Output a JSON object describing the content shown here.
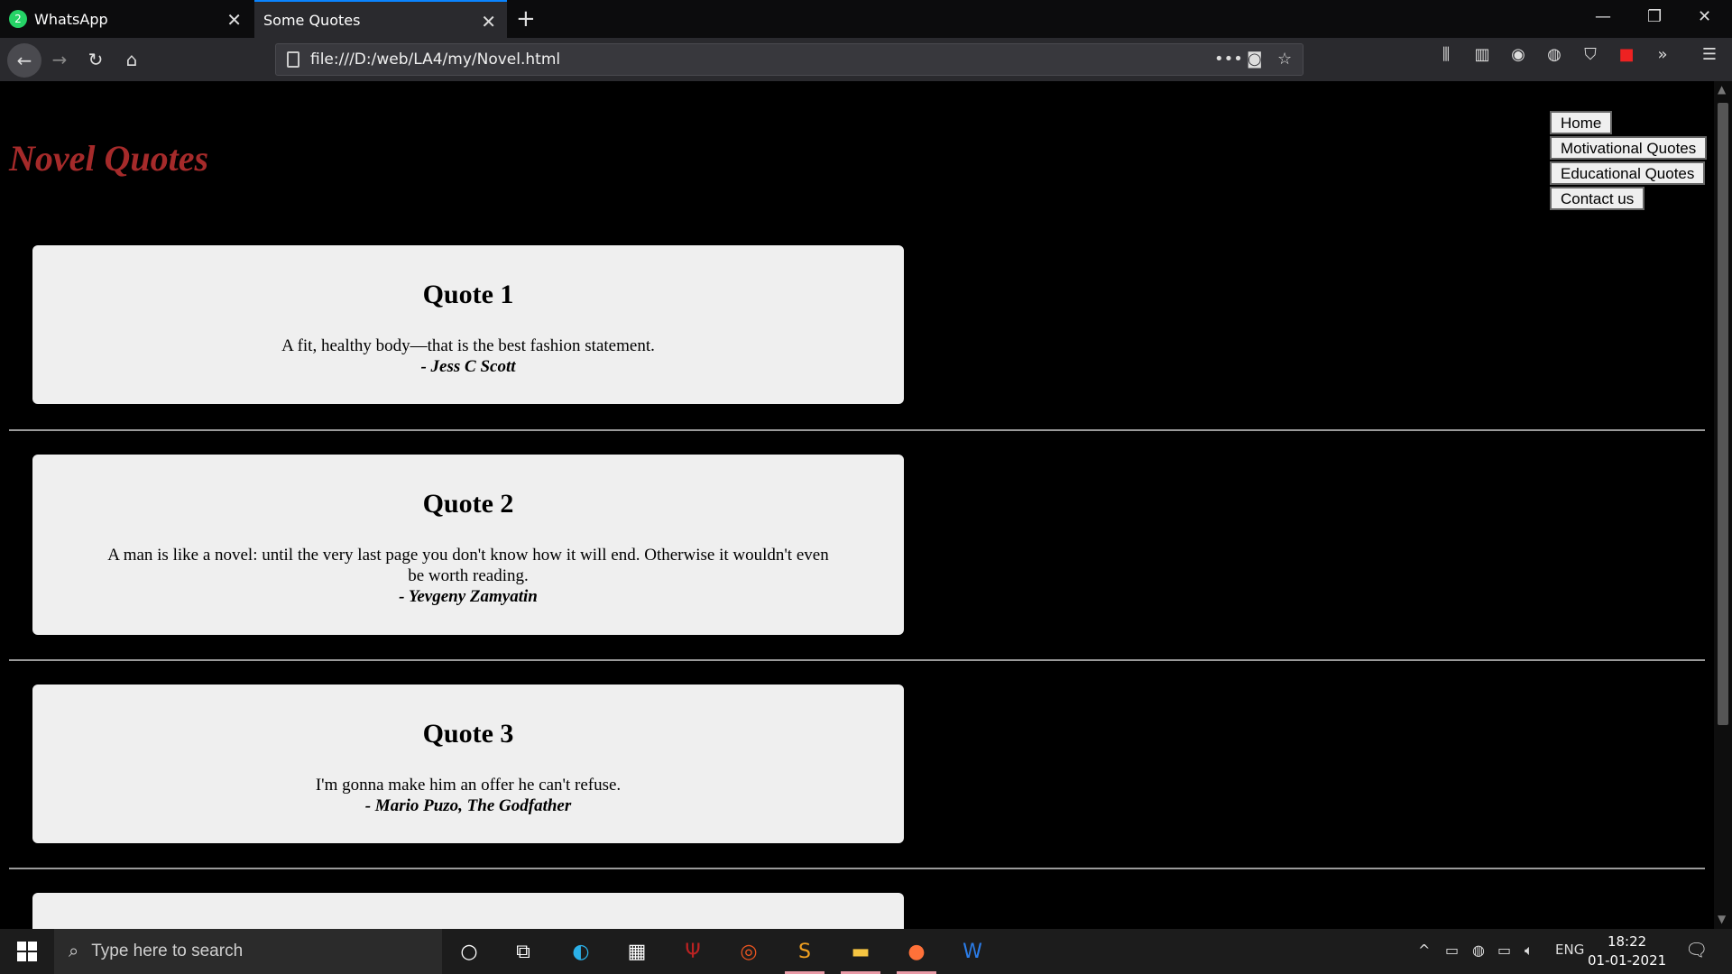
{
  "browser": {
    "tabs": [
      {
        "label": "WhatsApp",
        "badge": "2"
      },
      {
        "label": "Some Quotes"
      }
    ],
    "url": "file:///D:/web/LA4/my/Novel.html"
  },
  "page": {
    "title": "Novel Quotes",
    "nav": [
      "Home",
      "Motivational Quotes",
      "Educational Quotes",
      "Contact us"
    ],
    "quotes": [
      {
        "heading": "Quote 1",
        "text": "A fit, healthy body—that is the best fashion statement.",
        "author": "- Jess C Scott"
      },
      {
        "heading": "Quote 2",
        "text": "A man is like a novel: until the very last page you don't know how it will end. Otherwise it wouldn't even be worth reading.",
        "author": "- Yevgeny Zamyatin"
      },
      {
        "heading": "Quote 3",
        "text": "I'm gonna make him an offer he can't refuse.",
        "author": "- Mario Puzo, The Godfather"
      }
    ]
  },
  "taskbar": {
    "search_placeholder": "Type here to search",
    "language": "ENG",
    "time": "18:22",
    "date": "01-01-2021"
  },
  "colors": {
    "title": "#a52a2a",
    "card": "#efefef",
    "tab_accent": "#0a84ff"
  }
}
